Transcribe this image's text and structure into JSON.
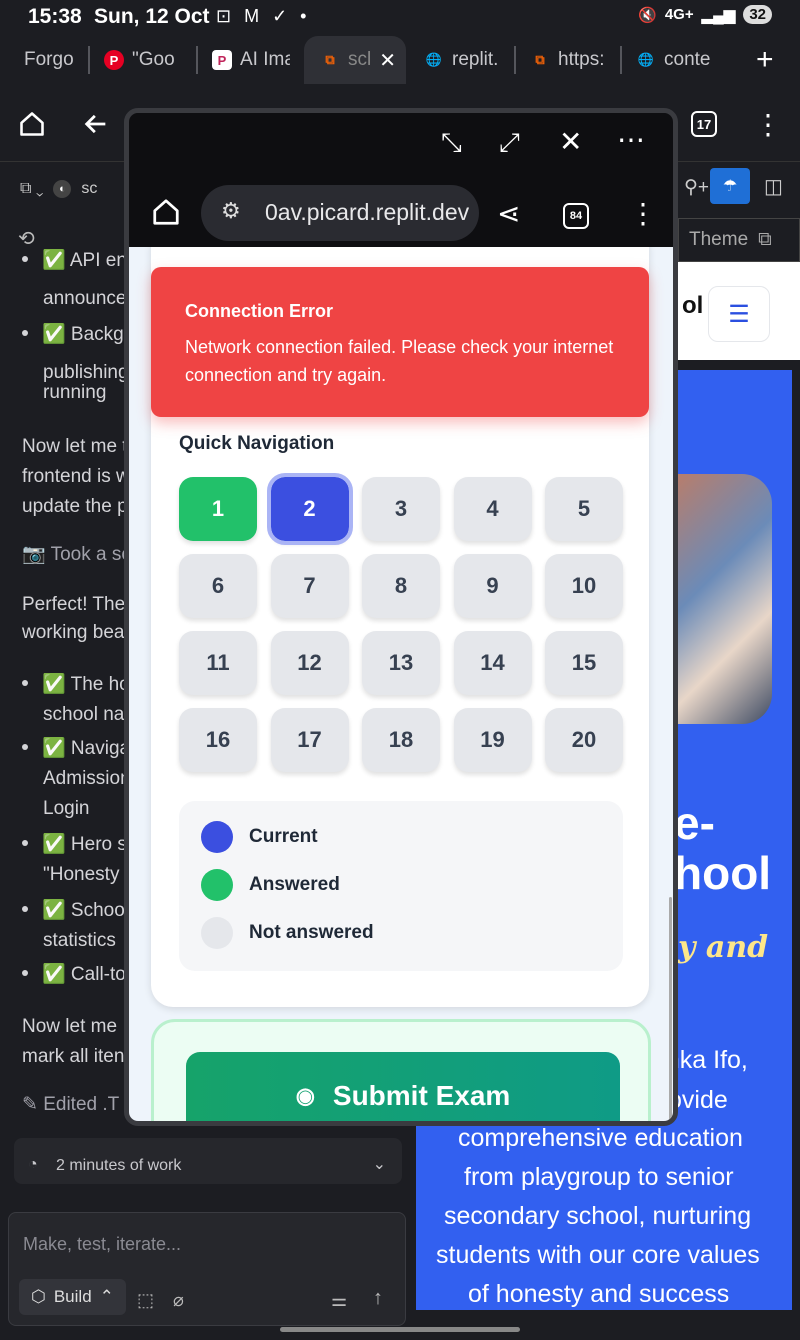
{
  "status_bar": {
    "time": "15:38",
    "date": "Sun, 12 Oct",
    "notif_icons": "⊡ M ✓ •",
    "network": "4G+",
    "battery": "32"
  },
  "tabs": [
    {
      "label": "Forgo",
      "icon": ""
    },
    {
      "label": "\"Goo",
      "icon": "P"
    },
    {
      "label": "AI Ima",
      "icon": "P"
    },
    {
      "label": "scl",
      "icon": "",
      "close": "✕"
    },
    {
      "label": "replit.",
      "icon": ""
    },
    {
      "label": "https:",
      "icon": ""
    },
    {
      "label": "conte",
      "icon": ""
    },
    {
      "label": "",
      "icon": "+"
    }
  ],
  "toolbar": {
    "tab_count": "17"
  },
  "left_panel": {
    "project_label": "sc",
    "items": [
      {
        "kind": "bullet",
        "text": "✅ API en"
      },
      {
        "kind": "cont",
        "text": "announce"
      },
      {
        "kind": "bullet",
        "text": "✅ Backgr"
      },
      {
        "kind": "cont",
        "text": "publishing"
      },
      {
        "kind": "cont",
        "text": "running"
      },
      {
        "kind": "para",
        "text": "Now let me t"
      },
      {
        "kind": "para",
        "text": "frontend is w"
      },
      {
        "kind": "para",
        "text": "update the p"
      },
      {
        "kind": "action",
        "text": "Took a sc"
      },
      {
        "kind": "para",
        "text": "Perfect! The"
      },
      {
        "kind": "para",
        "text": "working bea"
      },
      {
        "kind": "bullet",
        "text": "✅ The ho"
      },
      {
        "kind": "cont",
        "text": "school na"
      },
      {
        "kind": "bullet",
        "text": "✅ Naviga"
      },
      {
        "kind": "cont",
        "text": "Admission"
      },
      {
        "kind": "cont",
        "text": "Login"
      },
      {
        "kind": "bullet",
        "text": "✅ Hero s"
      },
      {
        "kind": "cont",
        "text": "\"Honesty"
      },
      {
        "kind": "bullet",
        "text": "✅ Schoo"
      },
      {
        "kind": "cont",
        "text": "statistics"
      },
      {
        "kind": "bullet",
        "text": "✅ Call-to"
      },
      {
        "kind": "para",
        "text": "Now let me"
      },
      {
        "kind": "para",
        "text": "mark all iten"
      },
      {
        "kind": "action",
        "text": "Edited .T"
      }
    ],
    "work_summary": "2 minutes of work",
    "input_placeholder": "Make, test, iterate...",
    "build_label": "Build"
  },
  "right_page": {
    "theme_label": "Theme",
    "logo_partial": "ol",
    "hero_lines": [
      "e-",
      "hool",
      "y and",
      "rinka Ifo,",
      "ovide",
      "comprehensive education",
      "from playgroup to senior",
      "secondary school, nurturing",
      "students with our core values",
      "of honesty and success"
    ]
  },
  "popup": {
    "url": "0av.picard.replit.dev",
    "tab_count": "84",
    "error": {
      "title": "Connection Error",
      "message": "Network connection failed. Please check your internet connection and try again."
    },
    "quick_nav_title": "Quick Navigation",
    "questions": [
      {
        "n": "1",
        "state": "answered"
      },
      {
        "n": "2",
        "state": "current"
      },
      {
        "n": "3",
        "state": "unanswered"
      },
      {
        "n": "4",
        "state": "unanswered"
      },
      {
        "n": "5",
        "state": "unanswered"
      },
      {
        "n": "6",
        "state": "unanswered"
      },
      {
        "n": "7",
        "state": "unanswered"
      },
      {
        "n": "8",
        "state": "unanswered"
      },
      {
        "n": "9",
        "state": "unanswered"
      },
      {
        "n": "10",
        "state": "unanswered"
      },
      {
        "n": "11",
        "state": "unanswered"
      },
      {
        "n": "12",
        "state": "unanswered"
      },
      {
        "n": "13",
        "state": "unanswered"
      },
      {
        "n": "14",
        "state": "unanswered"
      },
      {
        "n": "15",
        "state": "unanswered"
      },
      {
        "n": "16",
        "state": "unanswered"
      },
      {
        "n": "17",
        "state": "unanswered"
      },
      {
        "n": "18",
        "state": "unanswered"
      },
      {
        "n": "19",
        "state": "unanswered"
      },
      {
        "n": "20",
        "state": "unanswered"
      }
    ],
    "legend": [
      {
        "label": "Current",
        "color": "#3b4fe0"
      },
      {
        "label": "Answered",
        "color": "#22c16a"
      },
      {
        "label": "Not answered",
        "color": "#e5e7eb"
      }
    ],
    "submit_label": "Submit Exam"
  },
  "colors": {
    "error": "#ef4444",
    "answered": "#22c16a",
    "current": "#3b4fe0",
    "hero": "#3260f0"
  }
}
